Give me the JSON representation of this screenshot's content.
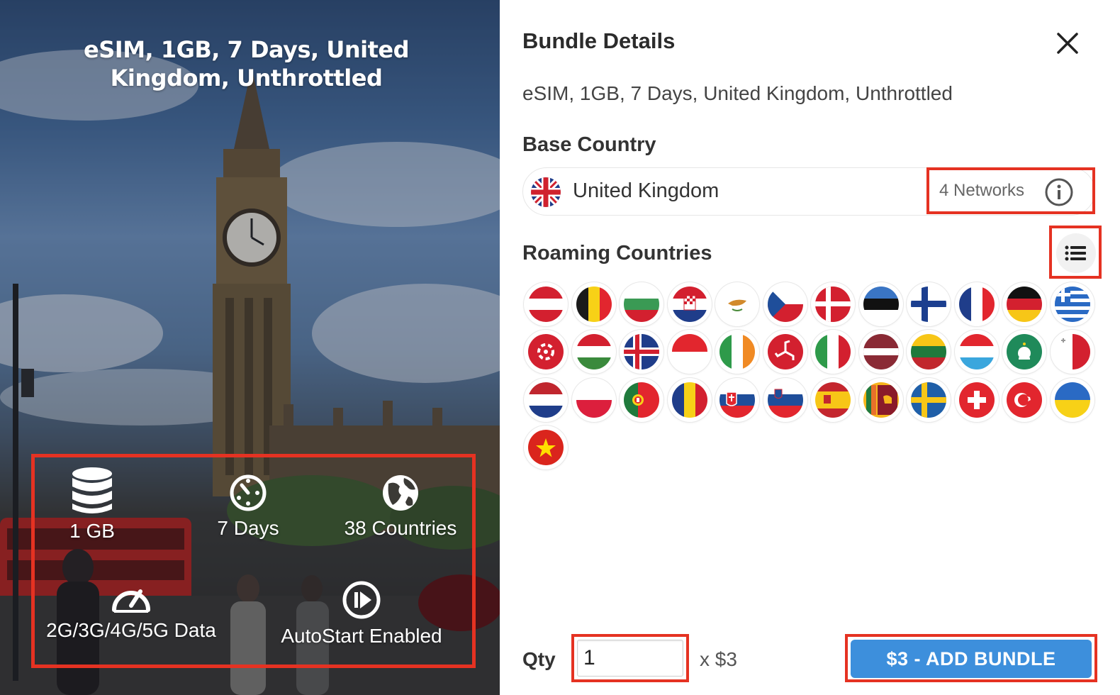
{
  "hero": {
    "title": "eSIM, 1GB, 7 Days, United Kingdom, Unthrottled",
    "features": {
      "data": "1 GB",
      "days": "7 Days",
      "countries": "38 Countries",
      "network": "2G/3G/4G/5G Data",
      "autostart": "AutoStart Enabled"
    }
  },
  "panel": {
    "title": "Bundle Details",
    "bundle_name": "eSIM, 1GB, 7 Days, United Kingdom, Unthrottled",
    "base_country_label": "Base Country",
    "base_country": "United Kingdom",
    "networks": "4 Networks",
    "roaming_label": "Roaming Countries",
    "roaming_flags": [
      "austria",
      "belgium",
      "bulgaria",
      "croatia",
      "cyprus",
      "czech-republic",
      "denmark",
      "estonia",
      "finland",
      "france",
      "germany",
      "greece",
      "hong-kong",
      "hungary",
      "iceland",
      "indonesia",
      "ireland",
      "isle-of-man",
      "italy",
      "latvia",
      "lithuania",
      "luxembourg",
      "macau",
      "malta",
      "netherlands",
      "poland",
      "portugal",
      "romania",
      "slovakia",
      "slovenia",
      "spain",
      "sri-lanka",
      "sweden",
      "switzerland",
      "turkey",
      "ukraine",
      "vietnam"
    ],
    "qty_label": "Qty",
    "qty_value": "1",
    "qty_price": "x $3",
    "add_button": "$3 - ADD BUNDLE"
  },
  "colors": {
    "accent": "#3d8fdc",
    "highlight": "#e53222"
  },
  "icons": {
    "close": "close-icon",
    "info": "info-icon",
    "list": "list-icon",
    "data": "database-icon",
    "days": "timer-icon",
    "countries": "globe-icon",
    "network": "speedometer-icon",
    "autostart": "play-icon"
  }
}
